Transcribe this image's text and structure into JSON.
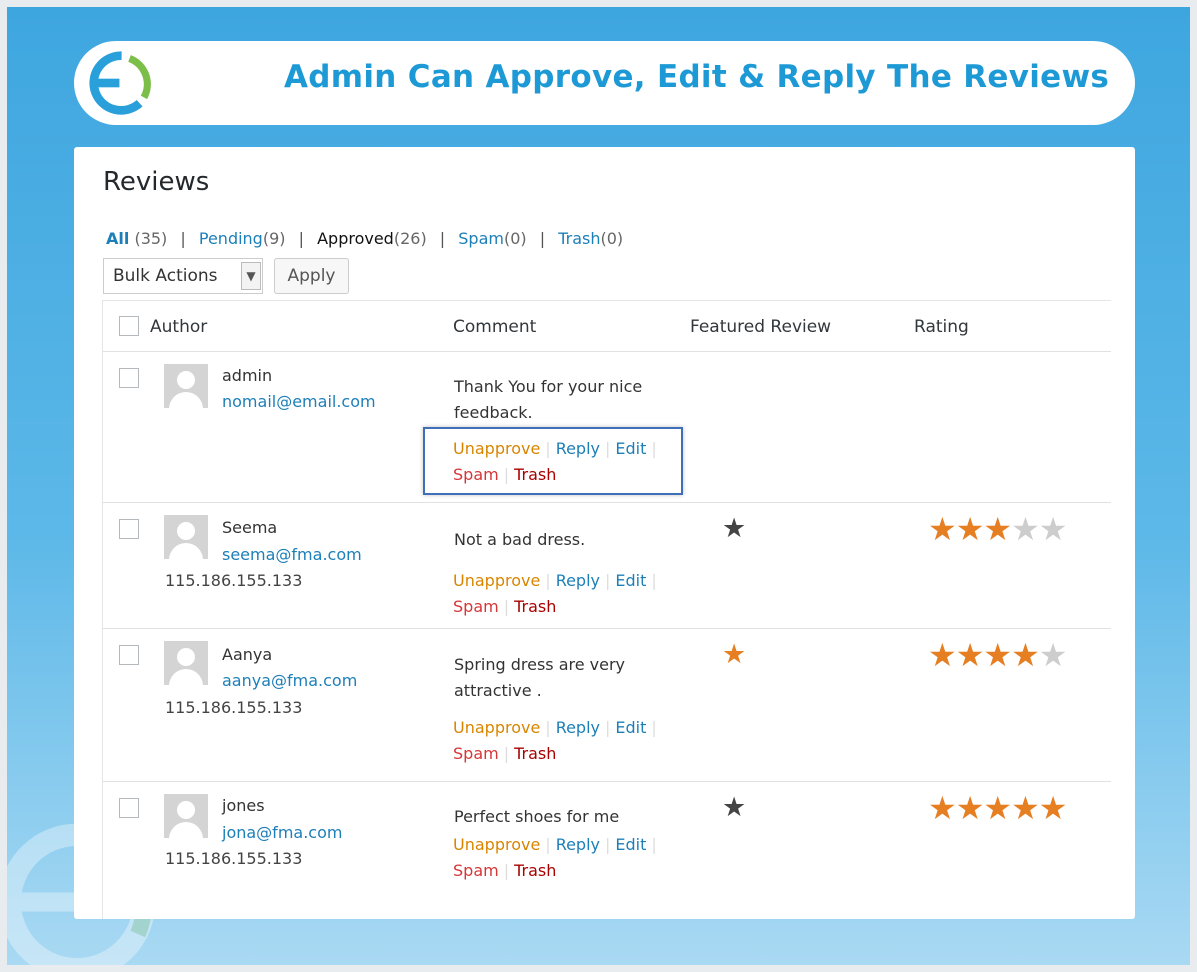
{
  "banner": {
    "title": "Admin Can Approve, Edit & Reply The Reviews"
  },
  "colors": {
    "accent": "#1d9ad6",
    "star_on": "#e67e22",
    "star_off": "#cdcdcd",
    "star_featured": "#444444",
    "link": "#1d7fb8"
  },
  "page": {
    "title": "Reviews"
  },
  "filters": {
    "all": {
      "label": "All",
      "count": "(35)"
    },
    "pending": {
      "label": "Pending",
      "count": "(9)"
    },
    "approved": {
      "label": "Approved",
      "count": "(26)"
    },
    "spam": {
      "label": "Spam",
      "count": "(0)"
    },
    "trash": {
      "label": "Trash",
      "count": "(0)"
    },
    "separator": "|"
  },
  "toolbar": {
    "bulk_actions": "Bulk Actions",
    "apply": "Apply"
  },
  "columns": {
    "author": "Author",
    "comment": "Comment",
    "featured": "Featured Review",
    "rating": "Rating"
  },
  "actions": {
    "unapprove": "Unapprove",
    "reply": "Reply",
    "edit": "Edit",
    "spam": "Spam",
    "trash": "Trash",
    "separator": "|"
  },
  "reviews": [
    {
      "name": "admin",
      "email": "nomail@email.com",
      "ip": "",
      "comment": "Thank You for your nice feedback.",
      "featured": null,
      "rating": null
    },
    {
      "name": "Seema",
      "email": "seema@fma.com",
      "ip": "115.186.155.133",
      "comment": "Not a bad dress.",
      "featured": false,
      "rating": 3
    },
    {
      "name": "Aanya",
      "email": "aanya@fma.com",
      "ip": "115.186.155.133",
      "comment": "Spring dress are very attractive .",
      "featured": true,
      "rating": 4
    },
    {
      "name": "jones",
      "email": "jona@fma.com",
      "ip": "115.186.155.133",
      "comment": "Perfect shoes for me",
      "featured": false,
      "rating": 5
    }
  ],
  "icons": {
    "featured": "star-icon",
    "rating": "star-icon",
    "avatar": "default-avatar-icon",
    "dropdown": "chevron-down-icon"
  }
}
